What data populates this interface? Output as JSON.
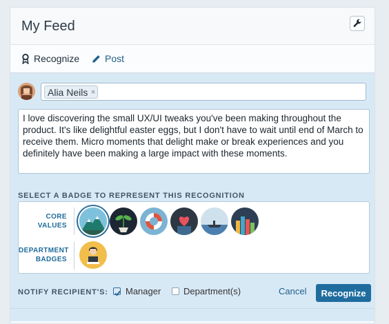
{
  "panel": {
    "title": "My Feed",
    "icons": {
      "settings": "wrench-icon"
    }
  },
  "tabs": [
    {
      "label": "Recognize",
      "icon": "award-ribbon-icon",
      "active": true
    },
    {
      "label": "Post",
      "icon": "pencil-icon",
      "active": false
    }
  ],
  "recipient": {
    "name": "Alia Neils",
    "remove_glyph": "×"
  },
  "message": {
    "text": "I love discovering the small UX/UI tweaks you've been making throughout the product. It's like delightful easter eggs, but I don't have to wait until end of March to receive them. Micro moments that delight make or break experiences and you definitely have been making a large impact with these moments."
  },
  "badges": {
    "heading": "SELECT A BADGE TO REPRESENT THIS RECOGNITION",
    "core_label_line1": "CORE",
    "core_label_line2": "VALUES",
    "dept_label_line1": "DEPARTMENT",
    "dept_label_line2": "BADGES",
    "core": [
      {
        "id": "mountain-badge-icon",
        "selected": true
      },
      {
        "id": "plant-sprout-badge-icon",
        "selected": false
      },
      {
        "id": "lifebuoy-badge-icon",
        "selected": false
      },
      {
        "id": "heart-hands-badge-icon",
        "selected": false
      },
      {
        "id": "boat-badge-icon",
        "selected": false
      },
      {
        "id": "city-skyline-badge-icon",
        "selected": false
      }
    ],
    "department": [
      {
        "id": "person-at-laptop-badge-icon",
        "selected": false
      }
    ]
  },
  "notify": {
    "label": "NOTIFY RECIPIENT'S:",
    "options": [
      {
        "label": "Manager",
        "checked": true
      },
      {
        "label": "Department(s)",
        "checked": false
      }
    ]
  },
  "actions": {
    "cancel": "Cancel",
    "submit": "Recognize"
  },
  "colors": {
    "accent": "#1f6d9f",
    "form_background": "#d8e9f6"
  }
}
